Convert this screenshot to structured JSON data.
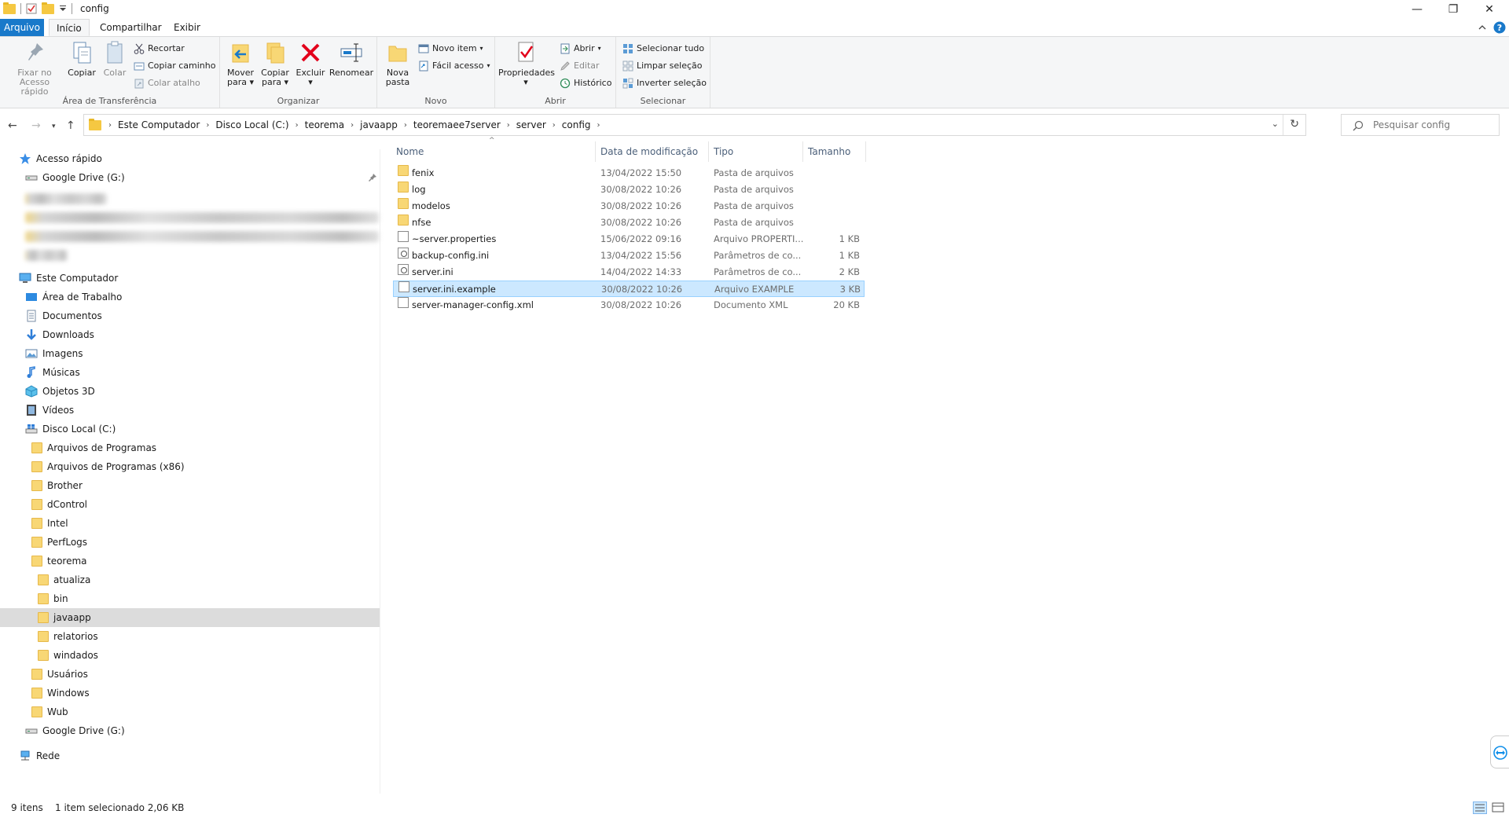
{
  "window": {
    "title": "config",
    "minimize_glyph": "—",
    "restore_glyph": "❐",
    "close_glyph": "✕"
  },
  "tabs": [
    {
      "label": "Arquivo"
    },
    {
      "label": "Início"
    },
    {
      "label": "Compartilhar"
    },
    {
      "label": "Exibir"
    }
  ],
  "ribbon": {
    "clipboard": {
      "label": "Área de Transferência",
      "pin_line1": "Fixar no",
      "pin_line2": "Acesso rápido",
      "copy": "Copiar",
      "paste": "Colar",
      "cut": "Recortar",
      "copy_path": "Copiar caminho",
      "paste_shortcut": "Colar atalho"
    },
    "organize": {
      "label": "Organizar",
      "move_line1": "Mover",
      "move_line2": "para",
      "copyto_line1": "Copiar",
      "copyto_line2": "para",
      "delete": "Excluir",
      "rename": "Renomear"
    },
    "new": {
      "label": "Novo",
      "newfolder_line1": "Nova",
      "newfolder_line2": "pasta",
      "new_item": "Novo item",
      "easy_access": "Fácil acesso"
    },
    "open": {
      "label": "Abrir",
      "properties": "Propriedades",
      "open": "Abrir",
      "edit": "Editar",
      "history": "Histórico"
    },
    "select": {
      "label": "Selecionar",
      "select_all": "Selecionar tudo",
      "select_none": "Limpar seleção",
      "invert": "Inverter seleção"
    }
  },
  "address": {
    "crumbs": [
      "Este Computador",
      "Disco Local (C:)",
      "teorema",
      "javaapp",
      "teoremaee7server",
      "server",
      "config"
    ]
  },
  "search": {
    "placeholder": "Pesquisar config"
  },
  "nav": {
    "quick_access": "Acesso rápido",
    "google_drive_pinned": "Google Drive (G:)",
    "this_pc": "Este Computador",
    "desktop": "Área de Trabalho",
    "documents": "Documentos",
    "downloads": "Downloads",
    "pictures": "Imagens",
    "music": "Músicas",
    "objects3d": "Objetos 3D",
    "videos": "Vídeos",
    "local_disk": "Disco Local (C:)",
    "folders": [
      "Arquivos de Programas",
      "Arquivos de Programas (x86)",
      "Brother",
      "dControl",
      "Intel",
      "PerfLogs",
      "teorema"
    ],
    "teorema_children": [
      "atualiza",
      "bin",
      "javaapp",
      "relatorios",
      "windados"
    ],
    "folders_after": [
      "Usuários",
      "Windows",
      "Wub"
    ],
    "google_drive": "Google Drive (G:)",
    "network": "Rede"
  },
  "list": {
    "columns": {
      "name": "Nome",
      "date": "Data de modificação",
      "type": "Tipo",
      "size": "Tamanho"
    },
    "rows": [
      {
        "name": "fenix",
        "date": "13/04/2022 15:50",
        "type": "Pasta de arquivos",
        "size": ""
      },
      {
        "name": "log",
        "date": "30/08/2022 10:26",
        "type": "Pasta de arquivos",
        "size": ""
      },
      {
        "name": "modelos",
        "date": "30/08/2022 10:26",
        "type": "Pasta de arquivos",
        "size": ""
      },
      {
        "name": "nfse",
        "date": "30/08/2022 10:26",
        "type": "Pasta de arquivos",
        "size": ""
      },
      {
        "name": "~server.properties",
        "date": "15/06/2022 09:16",
        "type": "Arquivo PROPERTI...",
        "size": "1 KB"
      },
      {
        "name": "backup-config.ini",
        "date": "13/04/2022 15:56",
        "type": "Parâmetros de co...",
        "size": "1 KB"
      },
      {
        "name": "server.ini",
        "date": "14/04/2022 14:33",
        "type": "Parâmetros de co...",
        "size": "2 KB"
      },
      {
        "name": "server.ini.example",
        "date": "30/08/2022 10:26",
        "type": "Arquivo EXAMPLE",
        "size": "3 KB"
      },
      {
        "name": "server-manager-config.xml",
        "date": "30/08/2022 10:26",
        "type": "Documento XML",
        "size": "20 KB"
      }
    ]
  },
  "status": {
    "count": "9 itens",
    "selection": "1 item selecionado  2,06 KB"
  },
  "colors": {
    "accent": "#1979ca",
    "selection": "#cce8ff",
    "folder": "#f8d775"
  }
}
